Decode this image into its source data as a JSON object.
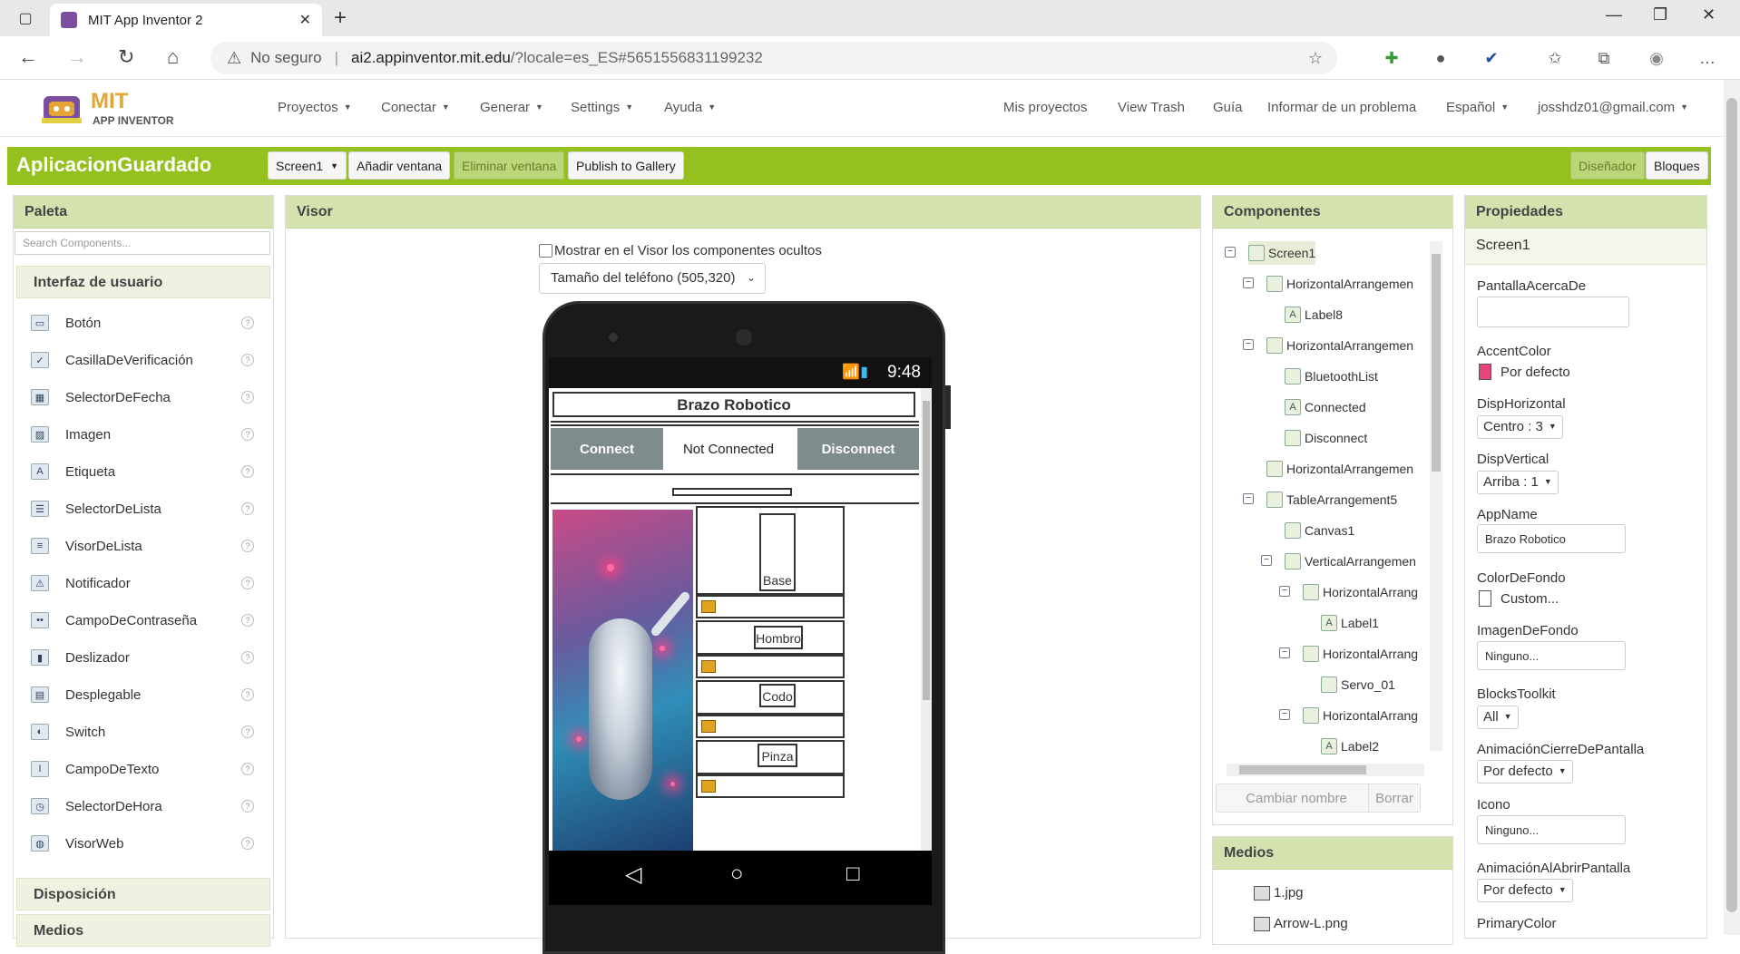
{
  "browser": {
    "tab_title": "MIT App Inventor 2",
    "security_label": "No seguro",
    "url_host": "ai2.appinventor.mit.edu",
    "url_path": "/?locale=es_ES#5651556831199232"
  },
  "header": {
    "logo_line1": "MIT",
    "logo_line2": "APP INVENTOR",
    "menus": [
      "Proyectos",
      "Conectar",
      "Generar",
      "Settings",
      "Ayuda"
    ],
    "right_links": [
      "Mis proyectos",
      "View Trash",
      "Guía",
      "Informar de un problema"
    ],
    "language": "Español",
    "account": "josshdz01@gmail.com"
  },
  "toolbar": {
    "project_name": "AplicacionGuardado",
    "screen_select": "Screen1",
    "add_screen": "Añadir ventana",
    "remove_screen": "Eliminar ventana",
    "publish": "Publish to Gallery",
    "designer": "Diseñador",
    "blocks": "Bloques"
  },
  "palette": {
    "title": "Paleta",
    "search_placeholder": "Search Components...",
    "section_ui": "Interfaz de usuario",
    "items": [
      {
        "label": "Botón",
        "icon": "button-icon"
      },
      {
        "label": "CasillaDeVerificación",
        "icon": "checkbox-icon"
      },
      {
        "label": "SelectorDeFecha",
        "icon": "datepicker-icon"
      },
      {
        "label": "Imagen",
        "icon": "image-icon"
      },
      {
        "label": "Etiqueta",
        "icon": "label-icon"
      },
      {
        "label": "SelectorDeLista",
        "icon": "listpicker-icon"
      },
      {
        "label": "VisorDeLista",
        "icon": "listview-icon"
      },
      {
        "label": "Notificador",
        "icon": "notifier-icon"
      },
      {
        "label": "CampoDeContraseña",
        "icon": "password-icon"
      },
      {
        "label": "Deslizador",
        "icon": "slider-icon"
      },
      {
        "label": "Desplegable",
        "icon": "spinner-icon"
      },
      {
        "label": "Switch",
        "icon": "switch-icon"
      },
      {
        "label": "CampoDeTexto",
        "icon": "textbox-icon"
      },
      {
        "label": "SelectorDeHora",
        "icon": "timepicker-icon"
      },
      {
        "label": "VisorWeb",
        "icon": "webviewer-icon"
      }
    ],
    "section_layout": "Disposición",
    "section_media": "Medios"
  },
  "viewer": {
    "title": "Visor",
    "show_hidden_label": "Mostrar en el Visor los componentes ocultos",
    "phone_size": "Tamaño del teléfono (505,320)",
    "status_time": "9:48",
    "app_title": "Brazo Robotico",
    "connect": "Connect",
    "status": "Not Connected",
    "disconnect": "Disconnect",
    "labels": [
      "Base",
      "Hombro",
      "Codo",
      "Pinza"
    ]
  },
  "components": {
    "title": "Componentes",
    "tree": [
      {
        "label": "Screen1",
        "level": 0,
        "toggle": "⊟",
        "selected": true
      },
      {
        "label": "HorizontalArrangemen",
        "level": 1,
        "toggle": "⊟"
      },
      {
        "label": "Label8",
        "level": 2,
        "toggle": ""
      },
      {
        "label": "HorizontalArrangemen",
        "level": 1,
        "toggle": "⊟"
      },
      {
        "label": "BluetoothList",
        "level": 2,
        "toggle": ""
      },
      {
        "label": "Connected",
        "level": 2,
        "toggle": ""
      },
      {
        "label": "Disconnect",
        "level": 2,
        "toggle": ""
      },
      {
        "label": "HorizontalArrangemen",
        "level": 1,
        "toggle": ""
      },
      {
        "label": "TableArrangement5",
        "level": 1,
        "toggle": "⊟"
      },
      {
        "label": "Canvas1",
        "level": 2,
        "toggle": ""
      },
      {
        "label": "VerticalArrangemen",
        "level": 2,
        "toggle": "⊟"
      },
      {
        "label": "HorizontalArrang",
        "level": 3,
        "toggle": "⊟"
      },
      {
        "label": "Label1",
        "level": 4,
        "toggle": ""
      },
      {
        "label": "HorizontalArrang",
        "level": 3,
        "toggle": "⊟"
      },
      {
        "label": "Servo_01",
        "level": 4,
        "toggle": ""
      },
      {
        "label": "HorizontalArrang",
        "level": 3,
        "toggle": "⊟"
      },
      {
        "label": "Label2",
        "level": 4,
        "toggle": ""
      }
    ],
    "rename": "Cambiar nombre",
    "delete": "Borrar"
  },
  "media": {
    "title": "Medios",
    "files": [
      "1.jpg",
      "Arrow-L.png"
    ]
  },
  "properties": {
    "title": "Propiedades",
    "component": "Screen1",
    "about_screen_label": "PantallaAcercaDe",
    "about_screen_value": "",
    "accent_label": "AccentColor",
    "accent_value": "Por defecto",
    "accent_color": "#e8457a",
    "halign_label": "DispHorizontal",
    "halign_value": "Centro : 3",
    "valign_label": "DispVertical",
    "valign_value": "Arriba : 1",
    "appname_label": "AppName",
    "appname_value": "Brazo Robotico",
    "bgcolor_label": "ColorDeFondo",
    "bgcolor_value": "Custom...",
    "bgimage_label": "ImagenDeFondo",
    "bgimage_value": "Ninguno...",
    "toolkit_label": "BlocksToolkit",
    "toolkit_value": "All",
    "close_anim_label": "AnimaciónCierreDePantalla",
    "close_anim_value": "Por defecto",
    "icon_label": "Icono",
    "icon_value": "Ninguno...",
    "open_anim_label": "AnimaciónAlAbrirPantalla",
    "open_anim_value": "Por defecto",
    "primary_label": "PrimaryColor"
  }
}
